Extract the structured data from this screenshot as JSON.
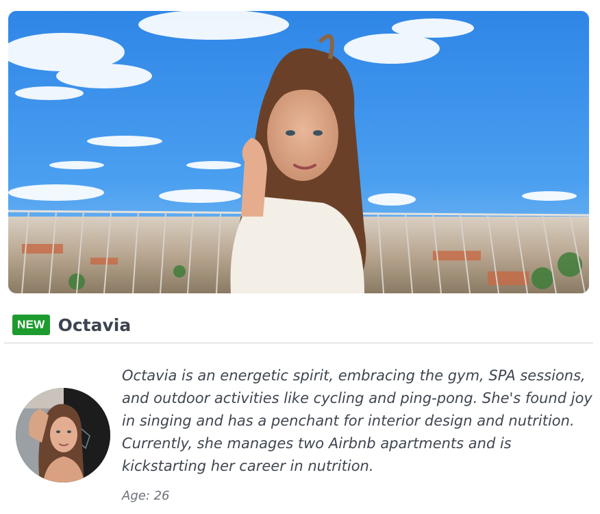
{
  "profile": {
    "badge": "NEW",
    "name": "Octavia",
    "bio": "Octavia is an energetic spirit, embracing the gym, SPA sessions, and outdoor activities like cycling and ping-pong. She's found joy in singing and has a penchant for interior design and nutrition. Currently, she manages two Airbnb apartments and is kickstarting her career in nutrition.",
    "age_label": "Age: 26"
  },
  "colors": {
    "badge_bg": "#1e9b2f",
    "name_text": "#3d4450",
    "body_text": "#3f4650",
    "divider": "#cfd2d6"
  }
}
